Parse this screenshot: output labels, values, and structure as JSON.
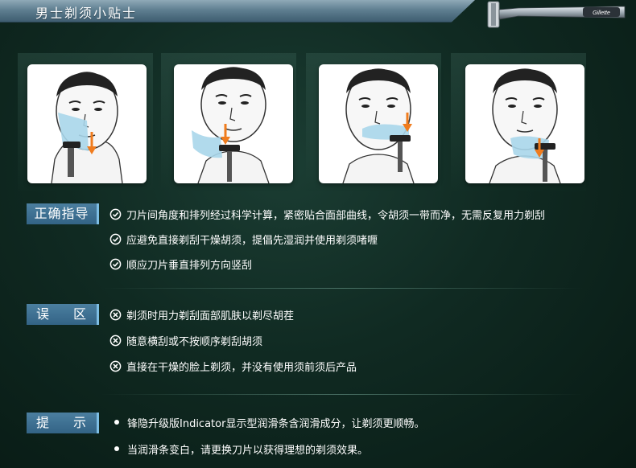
{
  "header": {
    "title": "男士剃须小贴士"
  },
  "razor": {
    "brand_text": "Gillette"
  },
  "steps": [
    {
      "icon": "shaving-step-1-illustration"
    },
    {
      "icon": "shaving-step-2-illustration"
    },
    {
      "icon": "shaving-step-3-illustration"
    },
    {
      "icon": "shaving-step-4-illustration"
    }
  ],
  "sections": {
    "correct": {
      "label": "正确指导",
      "items": [
        "刀片间角度和排列经过科学计算，紧密贴合面部曲线，令胡须一带而净，无需反复用力剃刮",
        "应避免直接剃刮干燥胡须，提倡先湿润并使用剃须啫喱",
        "顺应刀片垂直排列方向竖刮"
      ]
    },
    "mistakes": {
      "label_left": "误",
      "label_right": "区",
      "items": [
        "剃须时用力剃刮面部肌肤以剃尽胡茬",
        "随意横刮或不按顺序剃刮胡须",
        "直接在干燥的脸上剃须，并没有使用须前须后产品"
      ]
    },
    "tips": {
      "label_left": "提",
      "label_right": "示",
      "items": [
        "锋隐升级版Indicator显示型润滑条含润滑成分，让剃须更顺畅。",
        "当润滑条变白，请更换刀片以获得理想的剃须效果。"
      ]
    }
  },
  "colors": {
    "background": "#0f2a22",
    "header": "#5f7f91",
    "label": "#3f7294",
    "arrow": "#f07c1e",
    "foam": "#a9d6ea"
  }
}
